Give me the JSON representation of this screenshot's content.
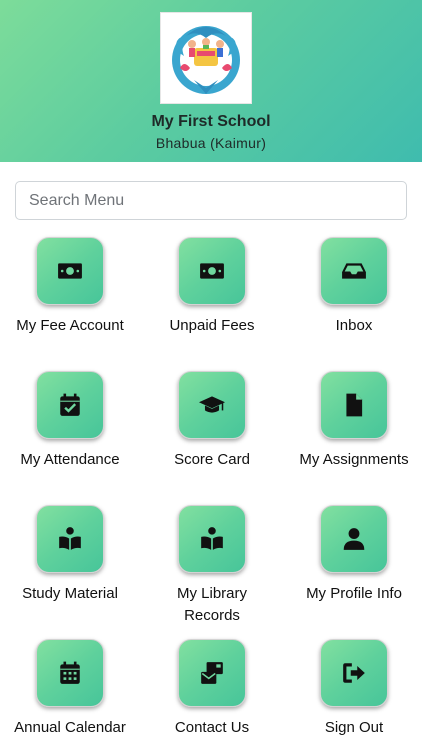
{
  "header": {
    "school_name": "My First School",
    "school_place": "Bhabua (Kaimur)"
  },
  "colors": {
    "header_gradient": [
      "#7ddc9a",
      "#3fbcae"
    ],
    "tile_gradient": [
      "#82e0a0",
      "#47c59a"
    ],
    "icon": "#111111"
  },
  "search": {
    "placeholder": "Search Menu",
    "value": ""
  },
  "menu": [
    {
      "label": "My Fee Account",
      "icon": "money-bill-icon"
    },
    {
      "label": "Unpaid Fees",
      "icon": "money-bill-icon"
    },
    {
      "label": "Inbox",
      "icon": "inbox-tray-icon"
    },
    {
      "label": "My Attendance",
      "icon": "calendar-check-icon"
    },
    {
      "label": "Score Card",
      "icon": "graduation-cap-icon"
    },
    {
      "label": "My Assignments",
      "icon": "file-icon"
    },
    {
      "label": "Study Material",
      "icon": "book-reader-icon"
    },
    {
      "label": "My Library Records",
      "icon": "book-reader-icon"
    },
    {
      "label": "My Profile Info",
      "icon": "user-icon"
    },
    {
      "label": "Annual Calendar",
      "icon": "calendar-grid-icon"
    },
    {
      "label": "Contact Us",
      "icon": "mail-bulk-icon"
    },
    {
      "label": "Sign Out",
      "icon": "sign-out-icon"
    }
  ]
}
